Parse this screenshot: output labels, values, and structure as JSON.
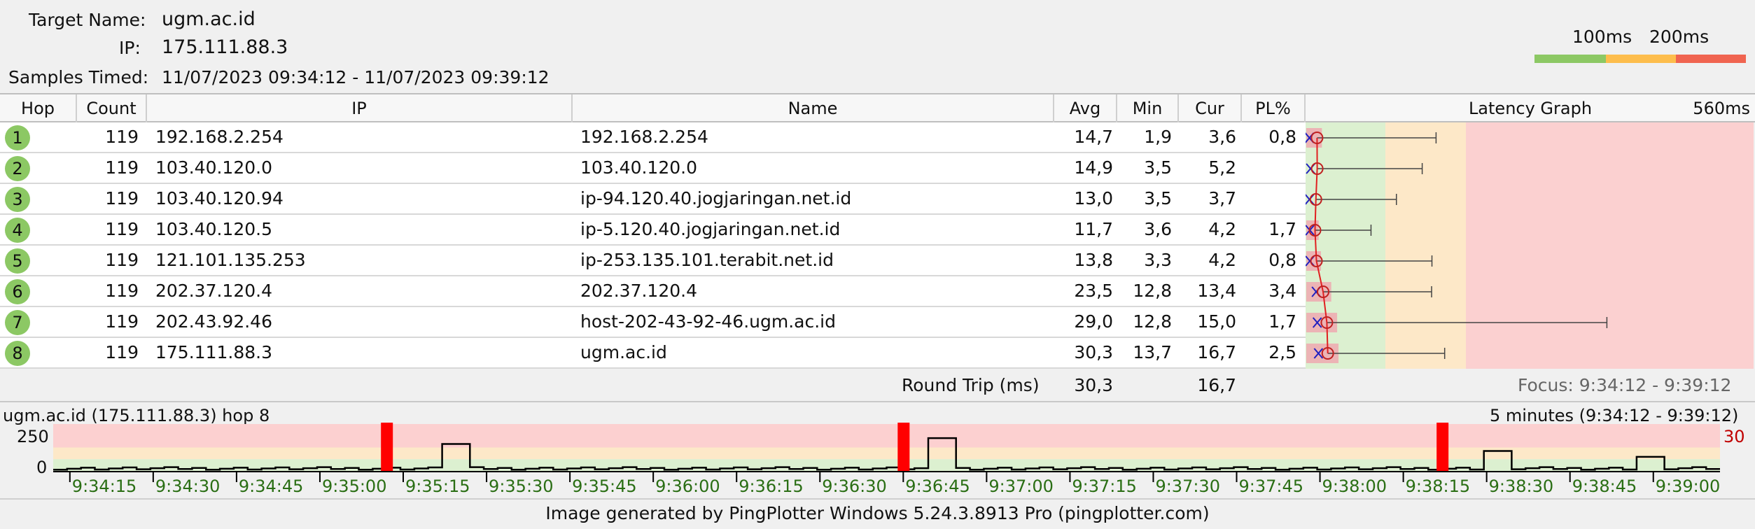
{
  "info": {
    "target_label": "Target Name:",
    "target_value": "ugm.ac.id",
    "ip_label": "IP:",
    "ip_value": "175.111.88.3",
    "samples_label": "Samples Timed:",
    "samples_value": "11/07/2023 09:34:12 - 11/07/2023 09:39:12"
  },
  "legend": {
    "label_100": "100ms",
    "label_200": "200ms",
    "colors": [
      "#8cc864",
      "#fdbd4c",
      "#f06450"
    ]
  },
  "table": {
    "headers": {
      "hop": "Hop",
      "count": "Count",
      "ip": "IP",
      "name": "Name",
      "avg": "Avg",
      "min": "Min",
      "cur": "Cur",
      "pl": "PL%",
      "graph": "Latency Graph",
      "scale": "560ms"
    },
    "rows": [
      {
        "hop": "1",
        "count": "119",
        "ip": "192.168.2.254",
        "name": "192.168.2.254",
        "avg": "14,7",
        "min": "1,9",
        "cur": "3,6",
        "pl": "0,8"
      },
      {
        "hop": "2",
        "count": "119",
        "ip": "103.40.120.0",
        "name": "103.40.120.0",
        "avg": "14,9",
        "min": "3,5",
        "cur": "5,2",
        "pl": ""
      },
      {
        "hop": "3",
        "count": "119",
        "ip": "103.40.120.94",
        "name": "ip-94.120.40.jogjaringan.net.id",
        "avg": "13,0",
        "min": "3,5",
        "cur": "3,7",
        "pl": ""
      },
      {
        "hop": "4",
        "count": "119",
        "ip": "103.40.120.5",
        "name": "ip-5.120.40.jogjaringan.net.id",
        "avg": "11,7",
        "min": "3,6",
        "cur": "4,2",
        "pl": "1,7"
      },
      {
        "hop": "5",
        "count": "119",
        "ip": "121.101.135.253",
        "name": "ip-253.135.101.terabit.net.id",
        "avg": "13,8",
        "min": "3,3",
        "cur": "4,2",
        "pl": "0,8"
      },
      {
        "hop": "6",
        "count": "119",
        "ip": "202.37.120.4",
        "name": "202.37.120.4",
        "avg": "23,5",
        "min": "12,8",
        "cur": "13,4",
        "pl": "3,4"
      },
      {
        "hop": "7",
        "count": "119",
        "ip": "202.43.92.46",
        "name": "host-202-43-92-46.ugm.ac.id",
        "avg": "29,0",
        "min": "12,8",
        "cur": "15,0",
        "pl": "1,7"
      },
      {
        "hop": "8",
        "count": "119",
        "ip": "175.111.88.3",
        "name": "ugm.ac.id",
        "avg": "30,3",
        "min": "13,7",
        "cur": "16,7",
        "pl": "2,5"
      }
    ],
    "roundtrip_label": "Round Trip (ms)",
    "roundtrip_avg": "30,3",
    "roundtrip_cur": "16,7",
    "focus": "Focus: 9:34:12 - 9:39:12"
  },
  "chart_data": {
    "type": "line",
    "title_left": "ugm.ac.id (175.111.88.3) hop 8",
    "title_right": "5 minutes (9:34:12 - 9:39:12)",
    "ytick_labels": [
      "250",
      "0"
    ],
    "pl_scale_label": "30",
    "x_ticks": [
      "9:34:15",
      "9:34:30",
      "9:34:45",
      "9:35:00",
      "9:35:15",
      "9:35:30",
      "9:35:45",
      "9:36:00",
      "9:36:15",
      "9:36:30",
      "9:36:45",
      "9:37:00",
      "9:37:15",
      "9:37:30",
      "9:37:45",
      "9:38:00",
      "9:38:15",
      "9:38:30",
      "9:38:45",
      "9:39:00"
    ],
    "ylim": [
      0,
      400
    ],
    "packet_loss_times": [
      "9:35:12",
      "9:36:45",
      "9:38:22"
    ]
  },
  "footer": "Image generated by PingPlotter Windows 5.24.3.8913 Pro (pingplotter.com)"
}
